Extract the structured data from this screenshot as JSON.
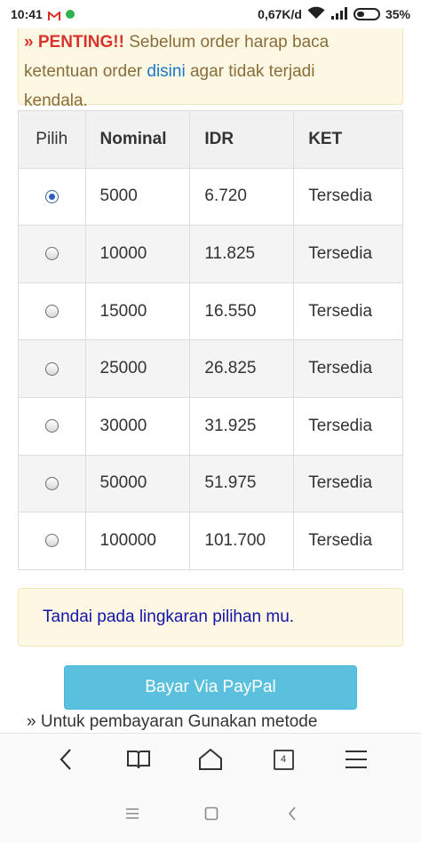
{
  "status_bar": {
    "time": "10:41",
    "network_speed": "0,67K/d",
    "battery_percent": "35%",
    "icons": [
      "gmail-icon",
      "whatsapp-icon",
      "wifi-icon",
      "signal-icon",
      "battery-icon"
    ]
  },
  "notice": {
    "important_label": "» PENTING!!",
    "text_top": " Sebelum order harap baca",
    "text_before_link": "ketentuan order ",
    "link_text": "disini",
    "text_after_link": " agar tidak terjadi",
    "text_end": "kendala."
  },
  "table": {
    "headers": [
      "Pilih",
      "Nominal",
      "IDR",
      "KET"
    ],
    "rows": [
      {
        "selected": true,
        "nominal": "5000",
        "idr": "6.720",
        "ket": "Tersedia"
      },
      {
        "selected": false,
        "nominal": "10000",
        "idr": "11.825",
        "ket": "Tersedia"
      },
      {
        "selected": false,
        "nominal": "15000",
        "idr": "16.550",
        "ket": "Tersedia"
      },
      {
        "selected": false,
        "nominal": "25000",
        "idr": "26.825",
        "ket": "Tersedia"
      },
      {
        "selected": false,
        "nominal": "30000",
        "idr": "31.925",
        "ket": "Tersedia"
      },
      {
        "selected": false,
        "nominal": "50000",
        "idr": "51.975",
        "ket": "Tersedia"
      },
      {
        "selected": false,
        "nominal": "100000",
        "idr": "101.700",
        "ket": "Tersedia"
      }
    ]
  },
  "hint": {
    "text": "Tandai pada lingkaran pilihan mu."
  },
  "paypal_button": {
    "label": "Bayar Via PayPal"
  },
  "method_note": {
    "text": "» Untuk pembayaran Gunakan metode"
  },
  "browser_toolbar": {
    "tab_count": "4",
    "icons": [
      "back-icon",
      "bookmarks-icon",
      "home-icon",
      "tabs-icon",
      "menu-icon"
    ]
  },
  "system_nav": {
    "icons": [
      "recents-icon",
      "home-nav-icon",
      "back-nav-icon"
    ]
  },
  "colors": {
    "notice_bg": "#fcf8e3",
    "important_red": "#d9342b",
    "link_blue": "#1a77c9",
    "hint_text": "#1414a8",
    "paypal_button": "#5bc0de"
  }
}
